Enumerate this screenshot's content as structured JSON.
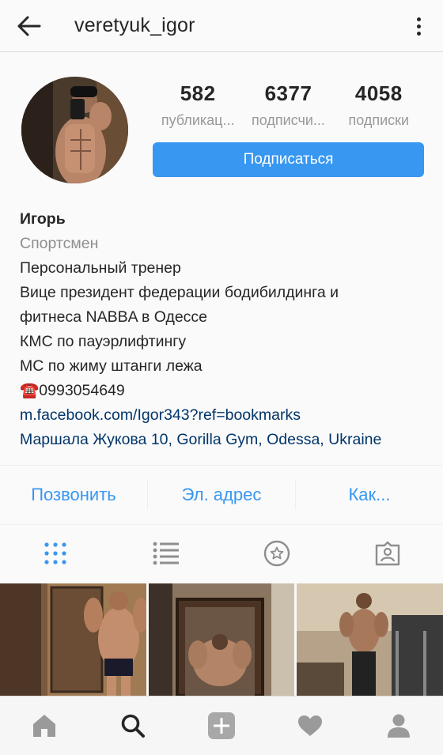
{
  "header": {
    "username": "veretyuk_igor",
    "back_icon": "arrow-left-icon",
    "menu_icon": "more-vertical-icon"
  },
  "profile": {
    "stats": [
      {
        "value": "582",
        "label": "публикац..."
      },
      {
        "value": "6377",
        "label": "подписчи..."
      },
      {
        "value": "4058",
        "label": "подписки"
      }
    ],
    "follow_label": "Подписаться",
    "name": "Игорь",
    "category": "Спортсмен",
    "bio_lines": [
      "Персональный тренер",
      "Вице президент федерации бодибилдинга и",
      "фитнеса NABBA в Одессе",
      "КМС по пауэрлифтингу",
      "МС по жиму штанги лежа"
    ],
    "phone_emoji": "☎️",
    "phone": "0993054649",
    "website": "m.facebook.com/Igor343?ref=bookmarks",
    "address": "Маршала Жукова 10, Gorilla Gym, Odessa, Ukraine"
  },
  "contacts": [
    {
      "label": "Позвонить"
    },
    {
      "label": "Эл. адрес"
    },
    {
      "label": "Как..."
    }
  ],
  "tabs": [
    "grid-icon",
    "list-icon",
    "star-icon",
    "tagged-icon"
  ],
  "bottom_nav": [
    "home-icon",
    "search-icon",
    "add-icon",
    "heart-icon",
    "profile-icon"
  ],
  "colors": {
    "accent": "#3897f0",
    "link": "#003569",
    "text": "#262626",
    "muted": "#8e8e8e"
  }
}
